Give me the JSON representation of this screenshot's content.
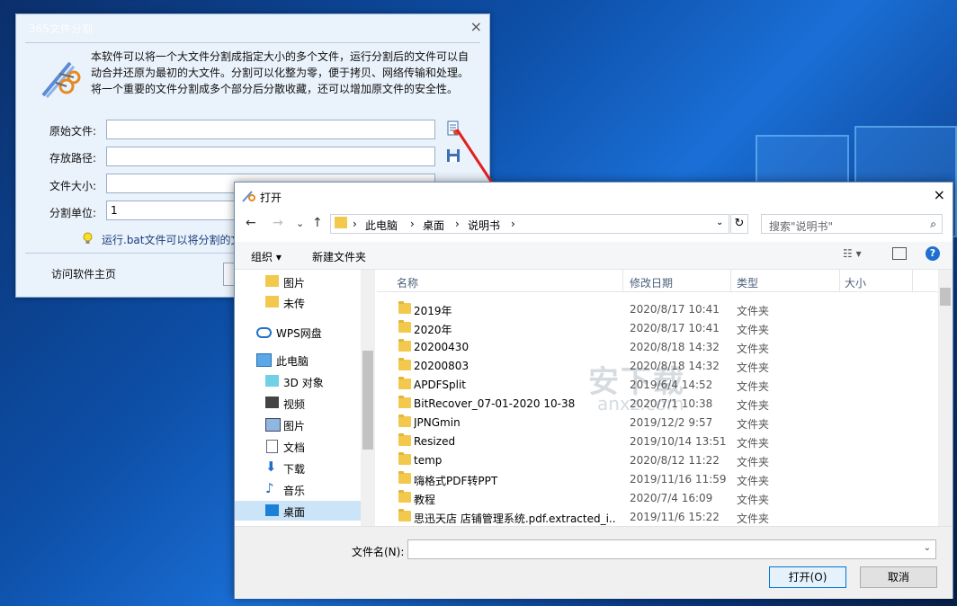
{
  "splitter": {
    "title": "365文件分割",
    "close_glyph": "×",
    "description": "本软件可以将一个大文件分割成指定大小的多个文件，运行分割后的文件可以自动合并还原为最初的大文件。分割可以化整为零，便于拷贝、网络传输和处理。将一个重要的文件分割成多个部分后分散收藏，还可以增加原文件的安全性。",
    "labels": {
      "source": "原始文件:",
      "save_path": "存放路径:",
      "file_size": "文件大小:",
      "unit": "分割单位:"
    },
    "values": {
      "source": "",
      "save_path": "",
      "file_size": "",
      "unit": "1"
    },
    "tip": "运行.bat文件可以将分割的文",
    "home_link": "访问软件主页"
  },
  "dialog": {
    "title": "打开",
    "close_glyph": "×",
    "nav": {
      "back": "←",
      "forward": "→",
      "dropdown": "⌄",
      "up": "↑"
    },
    "breadcrumb": [
      "此电脑",
      "桌面",
      "说明书"
    ],
    "breadcrumb_sep": "›",
    "refresh": "↻",
    "search_placeholder": "搜索\"说明书\"",
    "search_icon": "⌕",
    "organize": "组织 ▾",
    "new_folder": "新建文件夹",
    "views_glyph": "☷ ▾",
    "help": "?",
    "tree": [
      {
        "label": "图片",
        "icon": "folder"
      },
      {
        "label": "未传",
        "icon": "folder"
      },
      {
        "label": "WPS网盘",
        "icon": "cloud"
      },
      {
        "label": "此电脑",
        "icon": "computer"
      },
      {
        "label": "3D 对象",
        "icon": "cube"
      },
      {
        "label": "视频",
        "icon": "video"
      },
      {
        "label": "图片",
        "icon": "picture"
      },
      {
        "label": "文档",
        "icon": "document"
      },
      {
        "label": "下载",
        "icon": "download"
      },
      {
        "label": "音乐",
        "icon": "music"
      },
      {
        "label": "桌面",
        "icon": "desktop",
        "selected": true
      }
    ],
    "columns": {
      "name": "名称",
      "date": "修改日期",
      "type": "类型",
      "size": "大小"
    },
    "files": [
      {
        "name": "2019年",
        "date": "2020/8/17 10:41",
        "type": "文件夹"
      },
      {
        "name": "2020年",
        "date": "2020/8/17 10:41",
        "type": "文件夹"
      },
      {
        "name": "20200430",
        "date": "2020/8/18 14:32",
        "type": "文件夹"
      },
      {
        "name": "20200803",
        "date": "2020/8/18 14:32",
        "type": "文件夹"
      },
      {
        "name": "APDFSplit",
        "date": "2019/6/4 14:52",
        "type": "文件夹"
      },
      {
        "name": "BitRecover_07-01-2020 10-38",
        "date": "2020/7/1 10:38",
        "type": "文件夹"
      },
      {
        "name": "JPNGmin",
        "date": "2019/12/2 9:57",
        "type": "文件夹"
      },
      {
        "name": "Resized",
        "date": "2019/10/14 13:51",
        "type": "文件夹"
      },
      {
        "name": "temp",
        "date": "2020/8/12 11:22",
        "type": "文件夹"
      },
      {
        "name": "嗨格式PDF转PPT",
        "date": "2019/11/16 11:59",
        "type": "文件夹"
      },
      {
        "name": "教程",
        "date": "2020/7/4 16:09",
        "type": "文件夹"
      },
      {
        "name": "思迅天店 店铺管理系统.pdf.extracted_i...",
        "date": "2019/11/6 15:22",
        "type": "文件夹"
      }
    ],
    "watermark": {
      "brand": "安下载",
      "domain": "anxz.com"
    },
    "filename_label": "文件名(N):",
    "filename_value": "",
    "open_button": "打开(O)",
    "cancel_button": "取消"
  },
  "colors": {
    "accent": "#0078d7",
    "folder": "#f2c94c",
    "arrow": "#e02020"
  }
}
